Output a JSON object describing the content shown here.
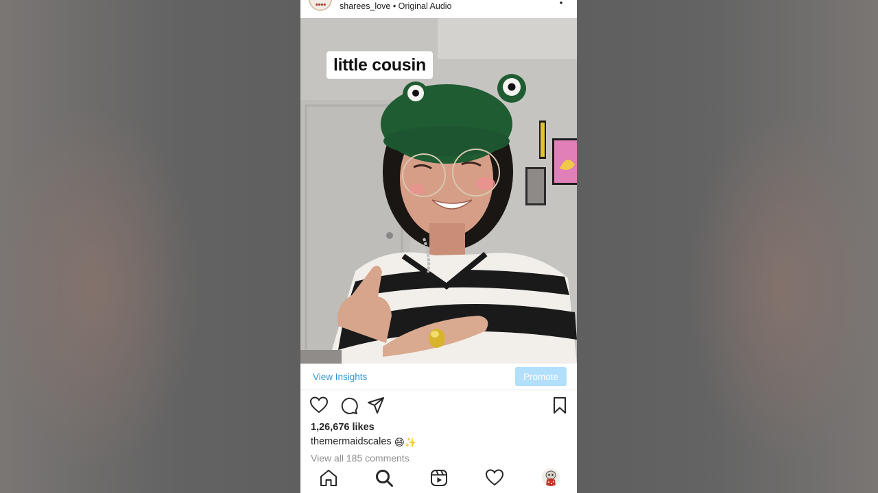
{
  "post": {
    "audio_line": "sharees_love • Original Audio",
    "avatar_text": "●●●●"
  },
  "video": {
    "overlay_caption": "little cousin"
  },
  "insights": {
    "view_insights_label": "View Insights",
    "promote_label": "Promote"
  },
  "actions": {
    "icons": [
      "heart-icon",
      "comment-icon",
      "share-icon",
      "bookmark-icon"
    ]
  },
  "likes_text": "1,26,676 likes",
  "caption": {
    "username": "themermaidscales",
    "emojis": "😄✨"
  },
  "comments_link": "View all 185 comments",
  "bottom_nav": {
    "icons": [
      "home-icon",
      "search-icon",
      "reels-icon",
      "activity-heart-icon",
      "profile-avatar"
    ]
  },
  "colors": {
    "link_blue": "#3897cf",
    "promote_bg": "#b2dffc",
    "text": "#262626",
    "muted": "#8e8e8e"
  }
}
